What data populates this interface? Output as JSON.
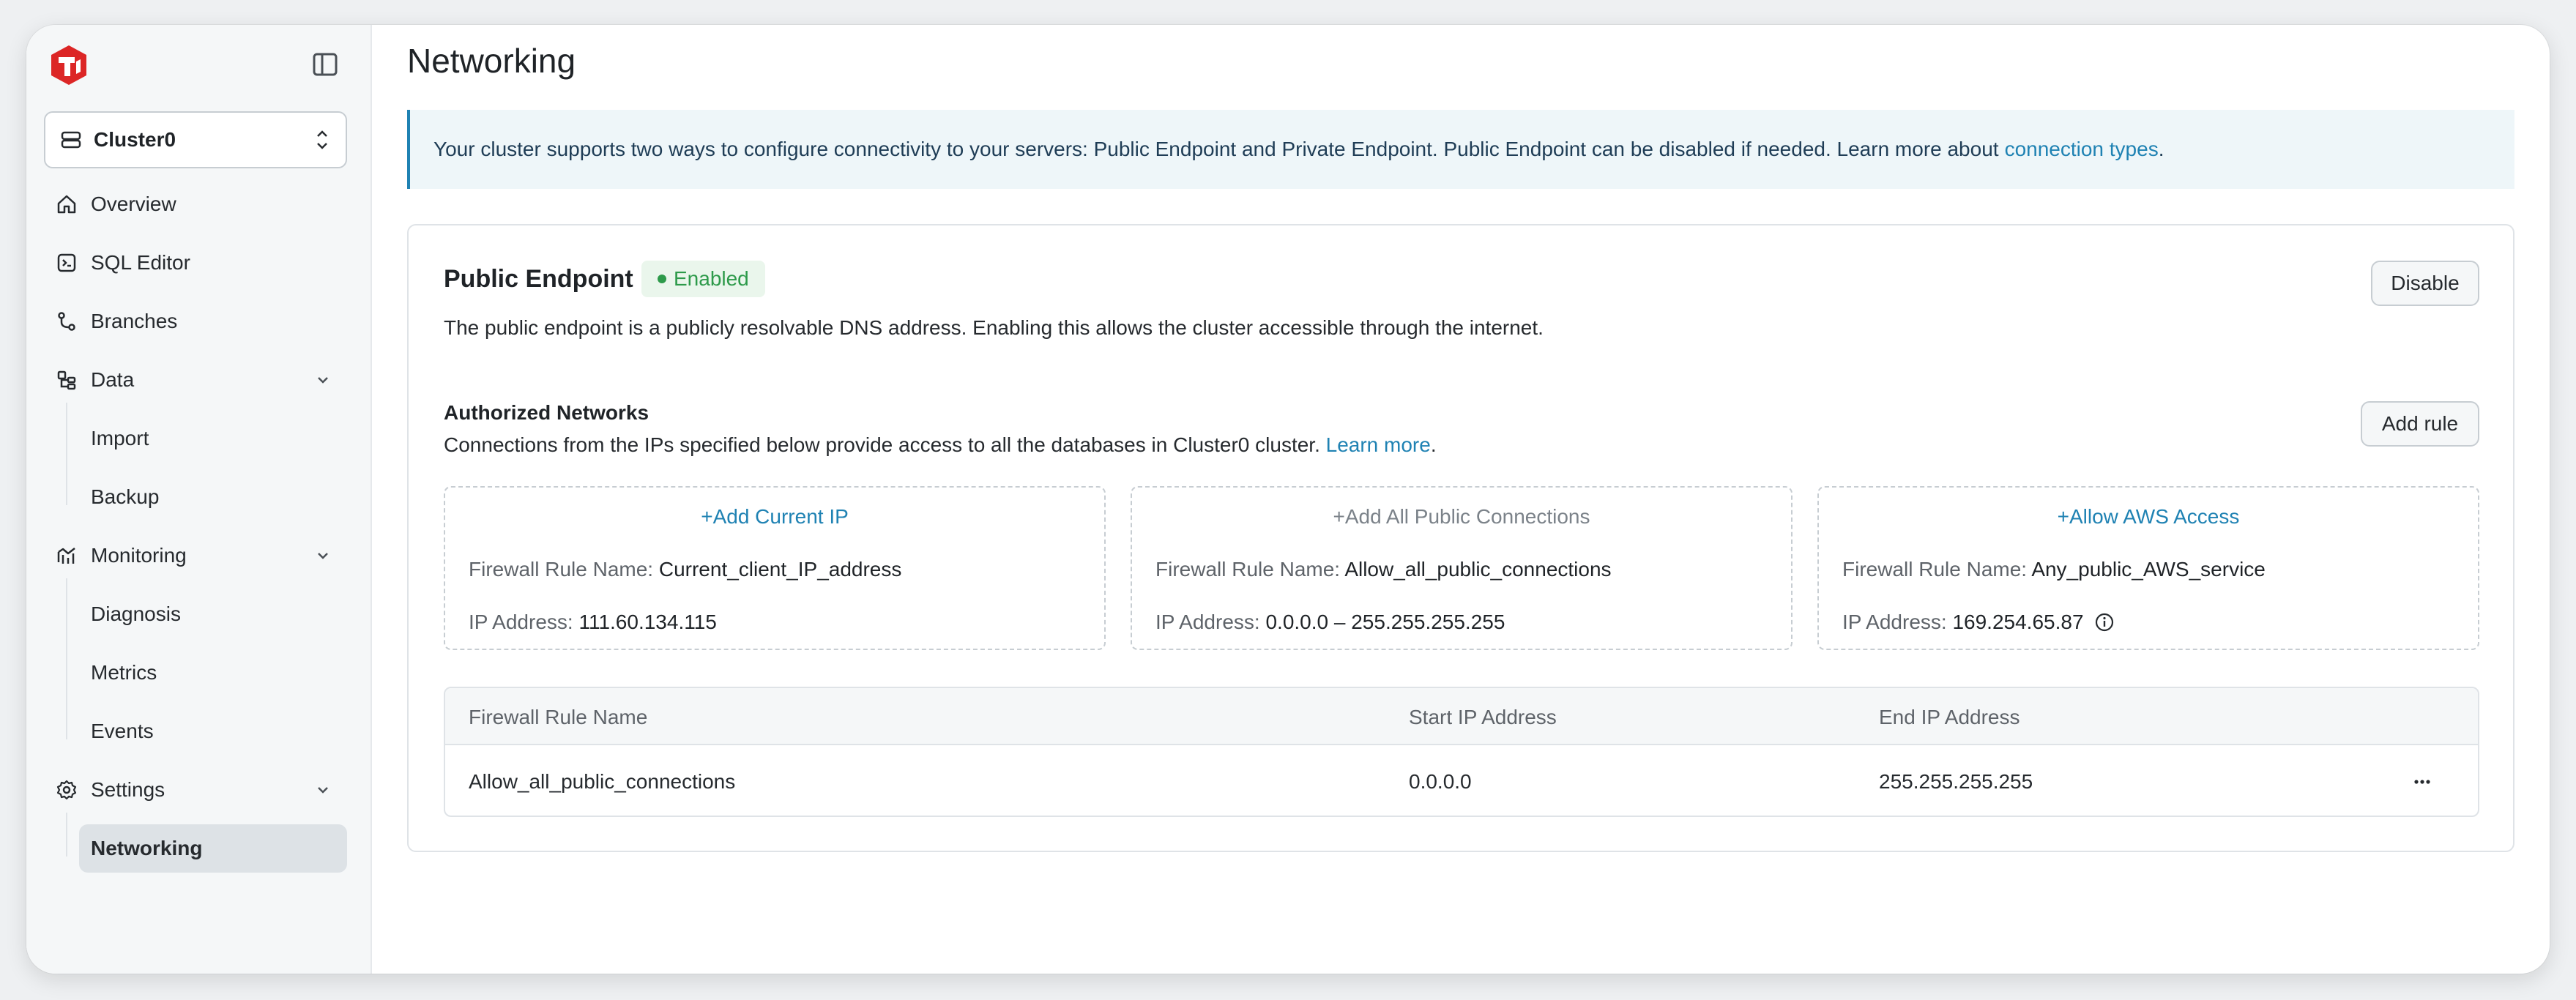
{
  "sidebar": {
    "cluster_name": "Cluster0",
    "nav": {
      "overview": "Overview",
      "sql_editor": "SQL Editor",
      "branches": "Branches",
      "data": "Data",
      "import": "Import",
      "backup": "Backup",
      "monitoring": "Monitoring",
      "diagnosis": "Diagnosis",
      "metrics": "Metrics",
      "events": "Events",
      "settings": "Settings",
      "networking": "Networking"
    }
  },
  "page": {
    "title": "Networking",
    "banner_text": "Your cluster supports two ways to configure connectivity to your servers: Public Endpoint and Private Endpoint. Public Endpoint can be disabled if needed. Learn more about",
    "banner_link": "connection types",
    "banner_period": "."
  },
  "public_endpoint": {
    "title": "Public Endpoint",
    "status": "Enabled",
    "description": "The public endpoint is a publicly resolvable DNS address. Enabling this allows the cluster accessible through the internet.",
    "disable_label": "Disable"
  },
  "authorized_networks": {
    "title": "Authorized Networks",
    "description": "Connections from the IPs specified below provide access to all the databases in Cluster0 cluster.",
    "learn_more": "Learn more",
    "period": ".",
    "add_rule_label": "Add rule",
    "field_rule_name": "Firewall Rule Name:",
    "field_ip": "IP Address:",
    "quick_rules": [
      {
        "action": "Add Current IP",
        "rule_name": "Current_client_IP_address",
        "ip": "111.60.134.115"
      },
      {
        "action": "Add All Public Connections",
        "rule_name": "Allow_all_public_connections",
        "ip": "0.0.0.0 – 255.255.255.255"
      },
      {
        "action": "Allow AWS Access",
        "rule_name": "Any_public_AWS_service",
        "ip": "169.254.65.87"
      }
    ]
  },
  "table": {
    "columns": [
      "Firewall Rule Name",
      "Start IP Address",
      "End IP Address"
    ],
    "rows": [
      {
        "name": "Allow_all_public_connections",
        "start": "0.0.0.0",
        "end": "255.255.255.255"
      }
    ]
  },
  "colors": {
    "accent": "#1f82b3",
    "success": "#2d9a4a",
    "brand": "#dc2626"
  }
}
